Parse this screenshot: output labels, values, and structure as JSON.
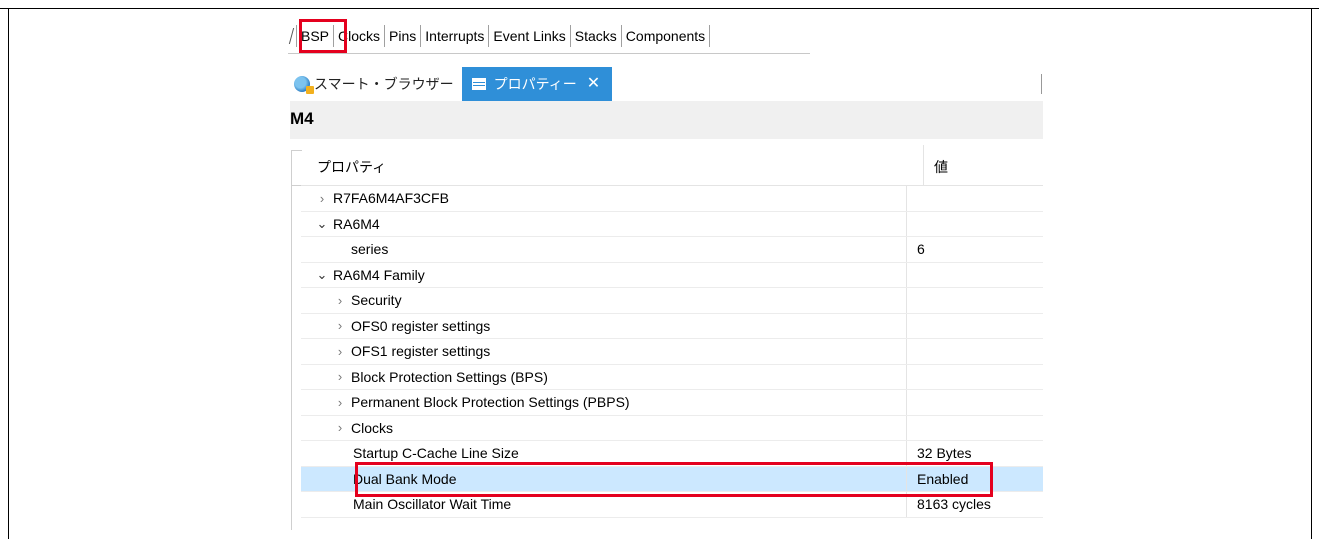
{
  "config_tabs": [
    "BSP",
    "Clocks",
    "Pins",
    "Interrupts",
    "Event Links",
    "Stacks",
    "Components"
  ],
  "view_tabs": {
    "smart_browser": "スマート・ブラウザー",
    "properties": "プロパティー"
  },
  "panel_title": "M4",
  "table": {
    "col_property": "プロパティ",
    "col_value": "値",
    "rows": [
      {
        "label": "R7FA6M4AF3CFB",
        "value": "",
        "level": 0,
        "expander": "closed"
      },
      {
        "label": "RA6M4",
        "value": "",
        "level": 0,
        "expander": "open"
      },
      {
        "label": "series",
        "value": "6",
        "level": 1,
        "expander": "none"
      },
      {
        "label": "RA6M4 Family",
        "value": "",
        "level": 0,
        "expander": "open"
      },
      {
        "label": "Security",
        "value": "",
        "level": 1,
        "expander": "closed"
      },
      {
        "label": "OFS0 register settings",
        "value": "",
        "level": 1,
        "expander": "closed"
      },
      {
        "label": "OFS1 register settings",
        "value": "",
        "level": 1,
        "expander": "closed"
      },
      {
        "label": "Block Protection Settings (BPS)",
        "value": "",
        "level": 1,
        "expander": "closed"
      },
      {
        "label": "Permanent Block Protection Settings (PBPS)",
        "value": "",
        "level": 1,
        "expander": "closed"
      },
      {
        "label": "Clocks",
        "value": "",
        "level": 1,
        "expander": "closed"
      },
      {
        "label": "Startup C-Cache Line Size",
        "value": "32 Bytes",
        "level": 2,
        "expander": "none"
      },
      {
        "label": "Dual Bank Mode",
        "value": "Enabled",
        "level": 2,
        "expander": "none",
        "selected": true
      },
      {
        "label": "Main Oscillator Wait Time",
        "value": "8163 cycles",
        "level": 2,
        "expander": "none"
      }
    ]
  },
  "colors": {
    "highlight_red": "#e4001e",
    "active_tab_blue": "#2f8fd8",
    "selection": "#cce8ff"
  }
}
